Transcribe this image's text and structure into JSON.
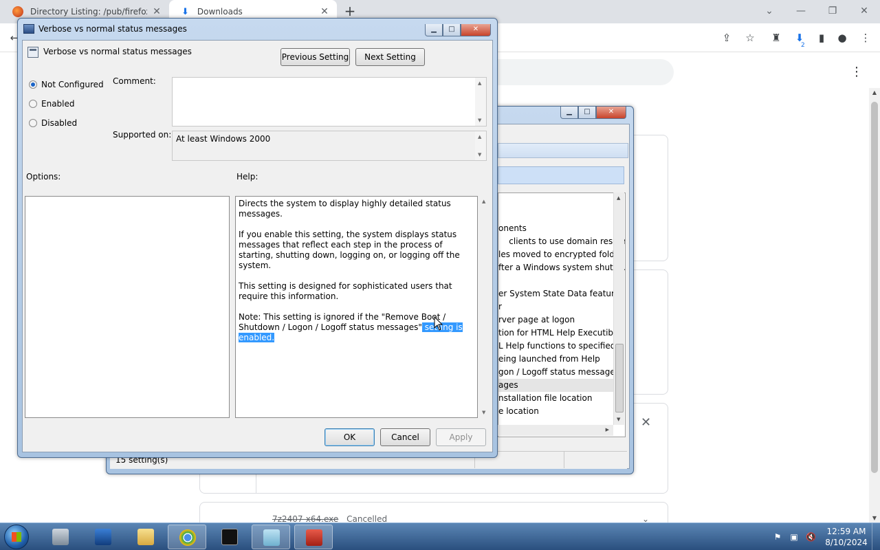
{
  "browser": {
    "tabs": [
      {
        "title": "Directory Listing: /pub/firefox/re",
        "icon": "firefox-icon"
      },
      {
        "title": "Downloads",
        "icon": "download-icon"
      }
    ],
    "new_tab": "+",
    "download_badge": "2"
  },
  "back_window": {
    "list_items": [
      "onents",
      "clients to use domain resour...",
      "les moved to encrypted fold...",
      "fter a Windows system shutd...",
      "er System State Data feature",
      "r",
      "rver page at logon",
      "tion for HTML Help Executible",
      "L Help functions to specified...",
      "eing launched from Help",
      "gon / Logoff status messages",
      "ages",
      "nstallation file location",
      "e location"
    ],
    "status": "15 setting(s)"
  },
  "downloads": {
    "file": "7z2407-x64.exe",
    "state": "Cancelled"
  },
  "dialog": {
    "title": "Verbose vs normal status messages",
    "setting_name": "Verbose vs normal status messages",
    "previous_label": "Previous Setting",
    "next_label": "Next Setting",
    "radios": [
      {
        "label": "Not Configured",
        "checked": true
      },
      {
        "label": "Enabled",
        "checked": false
      },
      {
        "label": "Disabled",
        "checked": false
      }
    ],
    "comment_label": "Comment:",
    "comment_value": "",
    "supported_label": "Supported on:",
    "supported_value": "At least Windows 2000",
    "options_label": "Options:",
    "help_label": "Help:",
    "help": {
      "p1": "Directs the system to display highly detailed status messages.",
      "p2": "If you enable this setting, the system displays status messages that reflect each step in the process of starting, shutting down, logging on, or logging off the system.",
      "p3": "This setting is designed for sophisticated users that require this information.",
      "p4_start": "Note: This setting is ignored if the \"Remove Boot / Shutdown / Logon / Logoff status messages\"",
      "p4_selected": " setting is enabled."
    },
    "ok_label": "OK",
    "cancel_label": "Cancel",
    "apply_label": "Apply"
  },
  "taskbar": {
    "time": "12:59 AM",
    "date": "8/10/2024"
  }
}
